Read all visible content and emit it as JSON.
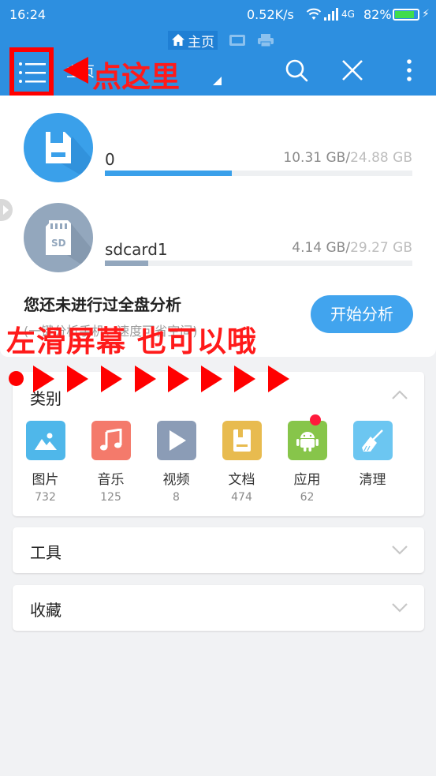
{
  "status": {
    "time": "16:24",
    "network_speed": "0.52K/s",
    "network_type": "4G",
    "battery": "82%",
    "icons": [
      "wifi-icon",
      "signal-icon",
      "battery-icon",
      "charging-icon"
    ]
  },
  "appbar": {
    "tabs": [
      {
        "label": "主页",
        "icon": "home-icon",
        "active": true
      },
      {
        "label": "",
        "icon": "image-tab-icon",
        "active": false
      },
      {
        "label": "",
        "icon": "printer-tab-icon",
        "active": false
      }
    ],
    "path_label": "主页",
    "actions": [
      "search-icon",
      "close-icon",
      "more-vertical-icon"
    ]
  },
  "annotations": {
    "menu_hint": "点这里",
    "swipe_hint": "左滑屏幕 也可以哦"
  },
  "drives": [
    {
      "name": "0",
      "used": "10.31 GB",
      "total": "24.88 GB",
      "used_fraction": 0.414,
      "color": "#3aa0ea",
      "icon": "sd-storage-icon"
    },
    {
      "name": "sdcard1",
      "used": "4.14 GB",
      "total": "29.27 GB",
      "used_fraction": 0.141,
      "color": "#93a7bd",
      "icon": "sd-card-icon"
    }
  ],
  "analysis": {
    "title": "您还未进行过全盘分析",
    "subtitle": "(一键分析手机，速度可省空间)",
    "button": "开始分析"
  },
  "categories": {
    "title": "类别",
    "items": [
      {
        "label": "图片",
        "count": "732",
        "color": "#4fb7ea",
        "icon": "picture-icon"
      },
      {
        "label": "音乐",
        "count": "125",
        "color": "#f47a6b",
        "icon": "music-icon"
      },
      {
        "label": "视频",
        "count": "8",
        "color": "#8b9cb6",
        "icon": "video-play-icon"
      },
      {
        "label": "文档",
        "count": "474",
        "color": "#e8bb4f",
        "icon": "document-icon"
      },
      {
        "label": "应用",
        "count": "62",
        "color": "#87c54a",
        "icon": "android-icon",
        "badge": true
      },
      {
        "label": "清理",
        "count": "",
        "color": "#6cc6f1",
        "icon": "broom-icon"
      }
    ]
  },
  "sections": [
    {
      "title": "工具"
    },
    {
      "title": "收藏"
    }
  ],
  "colors": {
    "primary": "#2d8fe0",
    "accent_button": "#41a4ee",
    "annotation_red": "#ff0000",
    "background": "#f1f2f4"
  }
}
